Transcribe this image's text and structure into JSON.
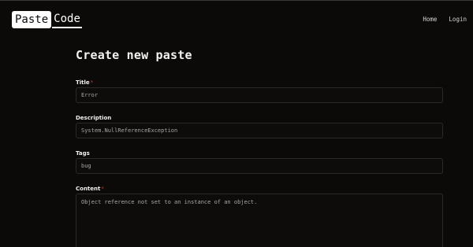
{
  "header": {
    "logo_left": "Paste",
    "logo_right": "Code",
    "nav": {
      "home": "Home",
      "login": "Login"
    }
  },
  "form": {
    "heading": "Create new paste",
    "required_marker": "*",
    "title": {
      "label": "Title",
      "value": "Error"
    },
    "description": {
      "label": "Description",
      "value": "System.NullReferenceException"
    },
    "tags": {
      "label": "Tags",
      "value": "bug"
    },
    "content": {
      "label": "Content",
      "value": "Object reference not set to an instance of an object."
    }
  },
  "colors": {
    "background": "#0b0a09",
    "required": "#b83a2e",
    "field_border": "#2a2927"
  }
}
